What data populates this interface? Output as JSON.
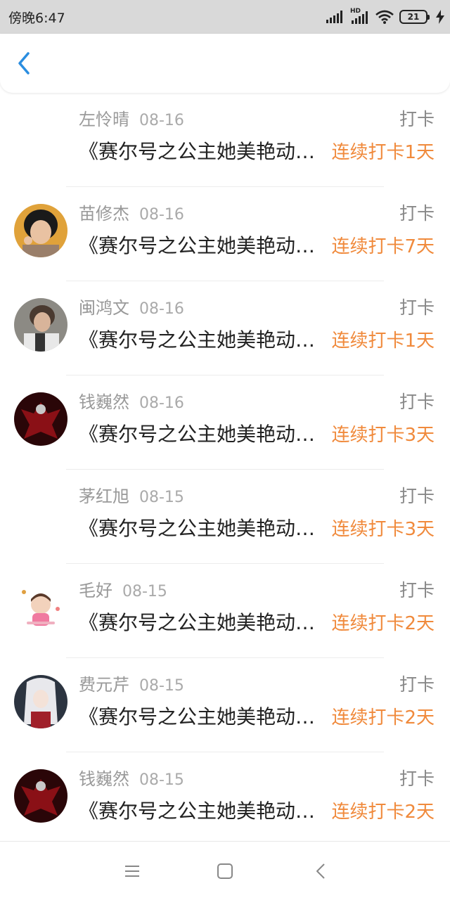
{
  "status_bar": {
    "time": "傍晚6:47",
    "hd_label": "HD",
    "battery": "21",
    "icons": [
      "signal-icon",
      "hd-signal-icon",
      "wifi-icon",
      "battery-icon",
      "charging-icon"
    ]
  },
  "nav": {
    "back_icon": "chevron-left-icon",
    "accent": "#2a8de0"
  },
  "colors": {
    "streak": "#f08a3c",
    "muted": "#999999"
  },
  "list": [
    {
      "name": "左怜晴",
      "date": "08-16",
      "action": "打卡",
      "title": "《赛尔号之公主她美艳动人》",
      "streak": "连续打卡1天",
      "avatar": "none"
    },
    {
      "name": "苗修杰",
      "date": "08-16",
      "action": "打卡",
      "title": "《赛尔号之公主她美艳动人》",
      "streak": "连续打卡7天",
      "avatar": "person-photo"
    },
    {
      "name": "闽鸿文",
      "date": "08-16",
      "action": "打卡",
      "title": "《赛尔号之公主她美艳动人》",
      "streak": "连续打卡1天",
      "avatar": "person-photo"
    },
    {
      "name": "钱巍然",
      "date": "08-16",
      "action": "打卡",
      "title": "《赛尔号之公主她美艳动人》",
      "streak": "连续打卡3天",
      "avatar": "dark-red-art"
    },
    {
      "name": "茅红旭",
      "date": "08-15",
      "action": "打卡",
      "title": "《赛尔号之公主她美艳动人》",
      "streak": "连续打卡3天",
      "avatar": "none"
    },
    {
      "name": "毛好",
      "date": "08-15",
      "action": "打卡",
      "title": "《赛尔号之公主她美艳动人》",
      "streak": "连续打卡2天",
      "avatar": "cartoon-girl"
    },
    {
      "name": "费元芹",
      "date": "08-15",
      "action": "打卡",
      "title": "《赛尔号之公主她美艳动人》",
      "streak": "连续打卡2天",
      "avatar": "anime-white-hair"
    },
    {
      "name": "钱巍然",
      "date": "08-15",
      "action": "打卡",
      "title": "《赛尔号之公主她美艳动人》",
      "streak": "连续打卡2天",
      "avatar": "dark-red-art"
    }
  ],
  "system_nav": {
    "icons": [
      "menu-icon",
      "home-square-icon",
      "back-triangle-icon"
    ]
  }
}
